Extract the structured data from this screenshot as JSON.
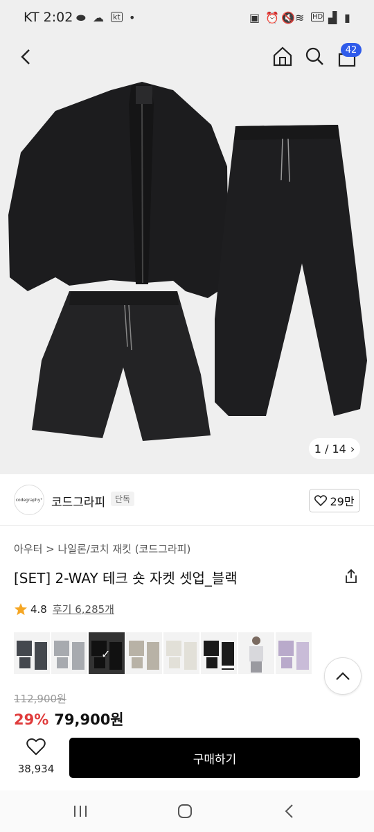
{
  "status": {
    "carrier_time": "KT 2:02",
    "net_badge": "kt",
    "hd_label": "HD"
  },
  "header": {
    "cart_count": "42"
  },
  "gallery": {
    "pager": "1 / 14",
    "pager_arrow": "›"
  },
  "brand": {
    "logo_text": "codegraphy°",
    "name": "코드그라피",
    "tag": "단독",
    "likes": "29만"
  },
  "product": {
    "breadcrumb": "아우터 > 나일론/코치 재킷 (코드그라피)",
    "title": "[SET] 2-WAY 테크 숏 자켓 셋업_블랙",
    "rating": "4.8",
    "reviews": "후기 6,285개",
    "original_price": "112,900원",
    "discount": "29%",
    "price": "79,900원"
  },
  "bottom": {
    "fav_count": "38,934",
    "buy_label": "구매하기"
  },
  "colors": {
    "accent": "#2f5bea",
    "discount": "#e03c3c",
    "star": "#f5a623"
  },
  "icons": [
    "back-icon",
    "home-icon",
    "search-icon",
    "cart-icon",
    "heart-icon",
    "share-icon",
    "star-icon",
    "chevron-up-icon",
    "recent-apps-icon",
    "home-nav-icon",
    "back-nav-icon"
  ]
}
